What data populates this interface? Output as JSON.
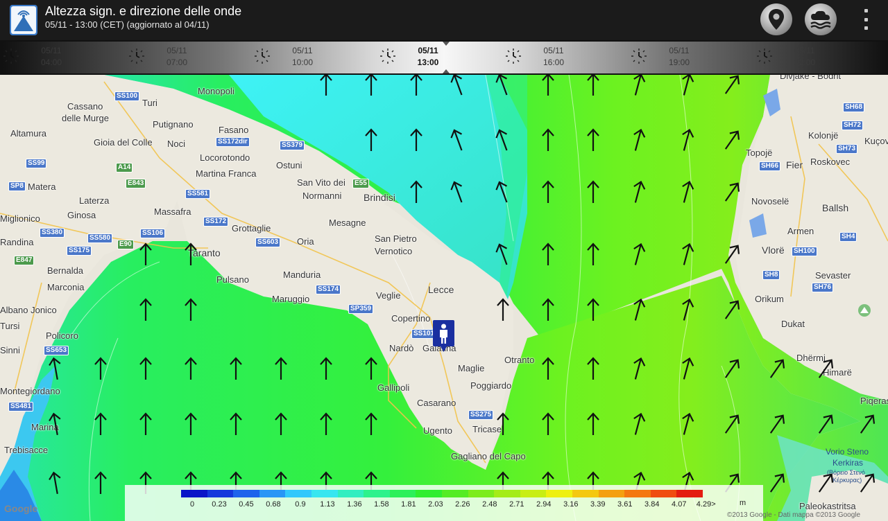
{
  "header": {
    "title": "Altezza sign. e direzione delle onde",
    "subtitle": "05/11 - 13:00 (CET) (aggiornato al 04/11)"
  },
  "actions": {
    "location_icon": "map-pin-icon",
    "weather_icon": "cloud-waves-icon",
    "overflow_icon": "overflow-menu-icon"
  },
  "timeline": [
    {
      "date": "05/11",
      "time": "04:00"
    },
    {
      "date": "05/11",
      "time": "07:00"
    },
    {
      "date": "05/11",
      "time": "10:00"
    },
    {
      "date": "05/11",
      "time": "13:00"
    },
    {
      "date": "05/11",
      "time": "16:00"
    },
    {
      "date": "05/11",
      "time": "19:00"
    },
    {
      "date": "05/11",
      "time": "22:00"
    }
  ],
  "map": {
    "places": [
      "Monopoli",
      "Cassano",
      "delle Murge",
      "Turi",
      "Putignano",
      "Fasano",
      "Altamura",
      "Gioia del Colle",
      "Noci",
      "Locorotondo",
      "Martina Franca",
      "Ostuni",
      "Matera",
      "Laterza",
      "Massafra",
      "Ginosa",
      "Miglionico",
      "Grottaglie",
      "San Vito dei",
      "Normanni",
      "Brindisi",
      "Mesagne",
      "Taranto",
      "San Pietro",
      "Vernotico",
      "Oria",
      "Bernalda",
      "Pulsano",
      "Manduria",
      "Marconia",
      "Maruggio",
      "Lecce",
      "Veglie",
      "Policoro",
      "Copertino",
      "Nardò",
      "Galatina",
      "Otranto",
      "Maglie",
      "Gallipoli",
      "Poggiardo",
      "Casarano",
      "Ugento",
      "Tricase",
      "Gagliano del Capo",
      "Montegiordano",
      "Marina",
      "Trebisacce",
      "Randina",
      "Tursi",
      "Albano Jonico",
      "Sinni",
      "Topojë",
      "Fier",
      "Roskovec",
      "Kolonjë",
      "Kuçov",
      "Novoselë",
      "Ballsh",
      "Armen",
      "Vlorë",
      "Sevaster",
      "Orikum",
      "Dukat",
      "Dhërmi",
      "Himarë",
      "Piqeras",
      "Paleokastritsa",
      "Divjakë - Bodrit"
    ],
    "roads": [
      "SS100",
      "SS172dir",
      "SS379",
      "SS99",
      "A14",
      "E843",
      "SS581",
      "SP8",
      "E55",
      "SS172",
      "SS380",
      "SS580",
      "SS106",
      "E90",
      "SS603",
      "SS175",
      "E847",
      "SS174",
      "SP359",
      "SS101",
      "SS653",
      "SS275",
      "SS481",
      "SH68",
      "SH72",
      "SH73",
      "SH66",
      "SH4",
      "SH100",
      "SH8",
      "SH76"
    ],
    "sea_label": [
      "Vorio Steno",
      "Kerkiras",
      "(Βόρειο Στενό",
      "Κέρκυρας)"
    ]
  },
  "legend": {
    "values": [
      "0",
      "0.23",
      "0.45",
      "0.68",
      "0.9",
      "1.13",
      "1.36",
      "1.58",
      "1.81",
      "2.03",
      "2.26",
      "2.48",
      "2.71",
      "2.94",
      "3.16",
      "3.39",
      "3.61",
      "3.84",
      "4.07",
      "4.29>"
    ],
    "unit": "m",
    "colors": [
      "#0a14c8",
      "#1438dc",
      "#1e64ec",
      "#2896f6",
      "#32c8fc",
      "#38e6f0",
      "#32eec0",
      "#2ef28c",
      "#2cf05a",
      "#30ee30",
      "#54ec24",
      "#7cec1c",
      "#a4ec18",
      "#c8ee14",
      "#eef010",
      "#f4c810",
      "#f4a010",
      "#f47810",
      "#f04c10",
      "#e41c10"
    ]
  },
  "attribution": {
    "google": "Google",
    "text": "©2013 Google - Dati mappa ©2013 Google"
  }
}
